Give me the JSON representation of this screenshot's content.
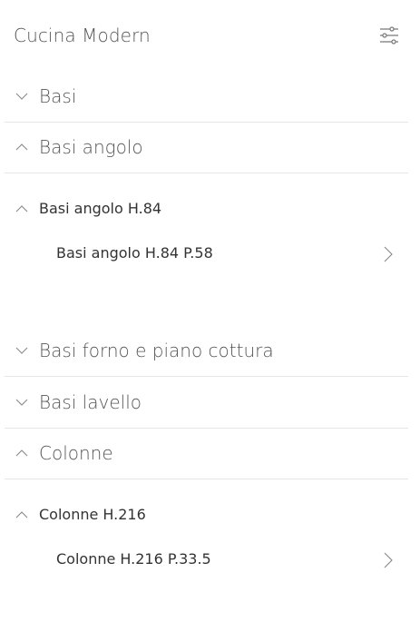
{
  "header": {
    "title": "Cucina Modern",
    "filter_icon": "sliders-icon"
  },
  "categories": [
    {
      "label": "Basi",
      "expanded": false
    },
    {
      "label": "Basi angolo",
      "expanded": true,
      "groups": [
        {
          "label": "Basi angolo H.84",
          "expanded": true,
          "items": [
            {
              "label": "Basi angolo H.84 P.58"
            }
          ]
        }
      ]
    },
    {
      "label": "Basi forno e piano cottura",
      "expanded": false
    },
    {
      "label": "Basi lavello",
      "expanded": false
    },
    {
      "label": "Colonne",
      "expanded": true,
      "groups": [
        {
          "label": "Colonne H.216",
          "expanded": true,
          "items": [
            {
              "label": "Colonne H.216 P.33.5"
            }
          ]
        }
      ]
    }
  ],
  "colors": {
    "text": "#555555",
    "divider": "#e6e6e6",
    "icon": "#888888"
  }
}
